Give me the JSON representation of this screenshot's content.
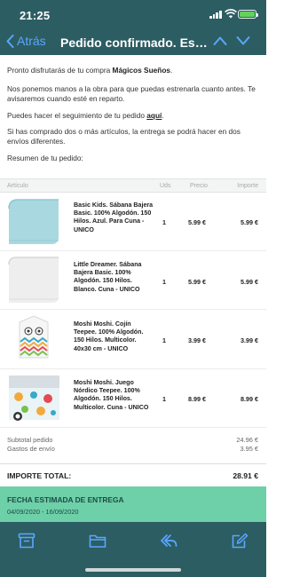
{
  "status_bar": {
    "time": "21:25"
  },
  "nav": {
    "back_label": "Atrás",
    "title": "Pedido confirmado. Eso es perfecto"
  },
  "email": {
    "intro_prefix": "Pronto disfrutarás de tu compra ",
    "brand": "Mágicos Sueños",
    "intro_suffix": ".",
    "p2": "Nos ponemos manos a la obra para que puedas estrenarla cuanto antes. Te avisaremos cuando esté en reparto.",
    "p3_prefix": "Puedes hacer el seguimiento de tu pedido ",
    "p3_link": "aquí",
    "p3_suffix": ".",
    "p4": "Si has comprado dos o más artículos, la entrega se podrá hacer en dos envíos diferentes.",
    "p5": "Resumen de tu pedido:"
  },
  "table": {
    "headers": {
      "article": "Artículo",
      "qty": "Uds",
      "price": "Precio",
      "amount": "Importe"
    },
    "items": [
      {
        "name": "Basic Kids. Sábana Bajera Basic. 100% Algodón. 150 Hilos. Azul. Para Cuna - UNICO",
        "qty": "1",
        "price": "5.99 €",
        "amount": "5.99 €"
      },
      {
        "name": "Little Dreamer. Sábana Bajera Basic. 100% Algodón. 150 Hilos. Blanco. Cuna - UNICO",
        "qty": "1",
        "price": "5.99 €",
        "amount": "5.99 €"
      },
      {
        "name": "Moshi Moshi. Cojín Teepee. 100% Algodón. 150 Hilos. Multicolor. 40x30 cm - UNICO",
        "qty": "1",
        "price": "3.99 €",
        "amount": "3.99 €"
      },
      {
        "name": "Moshi Moshi. Juego Nórdico Teepee. 100% Algodón. 150 Hilos. Multicolor. Cuna - UNICO",
        "qty": "1",
        "price": "8.99 €",
        "amount": "8.99 €"
      }
    ]
  },
  "totals": {
    "subtotal_label": "Subtotal pedido",
    "subtotal_value": "24.96 €",
    "shipping_label": "Gastos de envío",
    "shipping_value": "3.95 €",
    "grand_label": "IMPORTE TOTAL:",
    "grand_value": "28.91 €"
  },
  "delivery": {
    "title": "FECHA ESTIMADA DE ENTREGA",
    "dates": "04/09/2020 - 16/09/2020"
  },
  "toolbar": {
    "icons": [
      "archive-icon",
      "folder-icon",
      "reply-icon",
      "compose-icon"
    ]
  },
  "colors": {
    "bar": "#2c5d63",
    "accent": "#5aa7ff",
    "delivery": "#6dd0a8"
  }
}
